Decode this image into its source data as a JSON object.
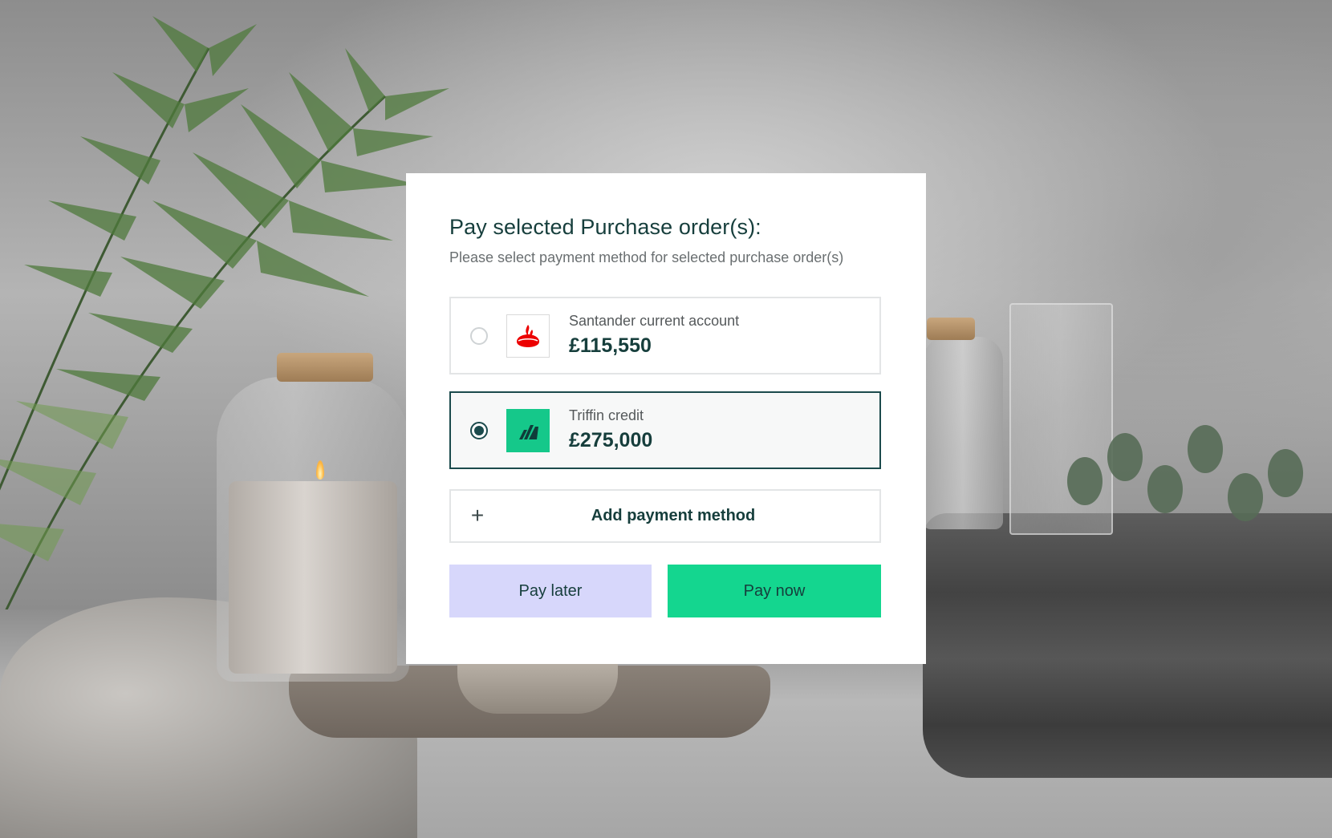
{
  "dialog": {
    "title": "Pay selected Purchase order(s):",
    "subtitle": "Please select payment method for selected purchase order(s)",
    "options": [
      {
        "label": "Santander current account",
        "amount": "£115,550",
        "icon": "santander-logo-icon",
        "selected": false,
        "brand_color": "#ec0000"
      },
      {
        "label": "Triffin credit",
        "amount": "£275,000",
        "icon": "triffin-logo-icon",
        "selected": true,
        "brand_color": "#15c88a"
      }
    ],
    "add_method": {
      "icon": "plus-icon",
      "label": "Add payment method"
    },
    "buttons": {
      "pay_later": "Pay later",
      "pay_now": "Pay now"
    }
  },
  "colors": {
    "heading": "#163e3c",
    "selected_border": "#1b4a4c",
    "pay_later_bg": "#d7d7fb",
    "pay_now_bg": "#14d68f"
  }
}
